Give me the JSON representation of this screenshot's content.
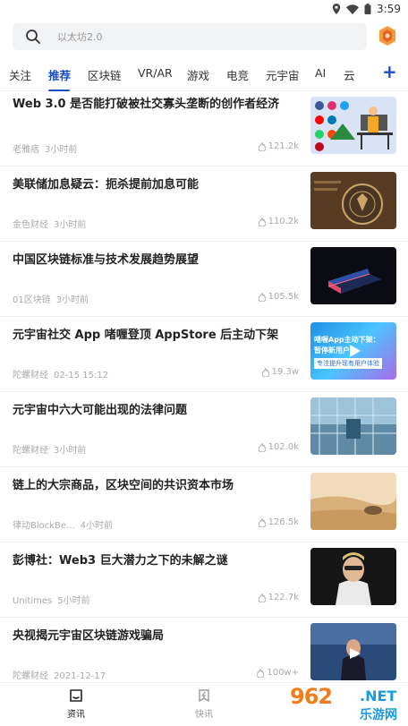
{
  "status": {
    "time": "3:59"
  },
  "search": {
    "placeholder": "以太坊2.0"
  },
  "tabs": [
    {
      "label": "关注"
    },
    {
      "label": "推荐"
    },
    {
      "label": "区块链"
    },
    {
      "label": "VR/AR"
    },
    {
      "label": "游戏"
    },
    {
      "label": "电竞"
    },
    {
      "label": "元宇宙"
    },
    {
      "label": "AI"
    },
    {
      "label": "云"
    }
  ],
  "tabs_plus": "+",
  "feed": [
    {
      "title": "Web 3.0 是否能打破被社交寡头垄断的创作者经济",
      "source": "老雅痞",
      "time": "3小时前",
      "views": "121.2k"
    },
    {
      "title": "美联储加息疑云：扼杀提前加息可能",
      "source": "金色财经",
      "time": "3小时前",
      "views": "110.2k"
    },
    {
      "title": "中国区块链标准与技术发展趋势展望",
      "source": "01区块链",
      "time": "3小时前",
      "views": "105.5k"
    },
    {
      "title": "元宇宙社交 App 啫喱登顶 AppStore 后主动下架",
      "source": "陀螺财经",
      "time": "02-15 15:12",
      "views": "19.3w",
      "thumb_text1": "啫喱App主动下架：",
      "thumb_text2": "暂停新用户",
      "thumb_text3": "专注提升现有用户体验"
    },
    {
      "title": "元宇宙中六大可能出现的法律问题",
      "source": "陀螺财经",
      "time": "3小时前",
      "views": "102.0k"
    },
    {
      "title": "链上的大宗商品，区块空间的共识资本市场",
      "source": "律动BlockBe...",
      "time": "4小时前",
      "views": "126.5k"
    },
    {
      "title": "彭博社：Web3 巨大潜力之下的未解之谜",
      "source": "Unitimes",
      "time": "5小时前",
      "views": "122.7k"
    },
    {
      "title": "央视揭元宇宙区块链游戏骗局",
      "source": "陀螺财经",
      "time": "2021-12-17",
      "views": "100w+"
    }
  ],
  "bottom_nav": [
    {
      "label": "资讯"
    },
    {
      "label": "快讯"
    }
  ],
  "watermark": {
    "num": "962",
    "net": ".NET",
    "cn": "乐游网"
  },
  "colors": {
    "accent": "#1a4fc7",
    "watermark_orange": "#f07d1a",
    "watermark_blue": "#1a9be0"
  }
}
